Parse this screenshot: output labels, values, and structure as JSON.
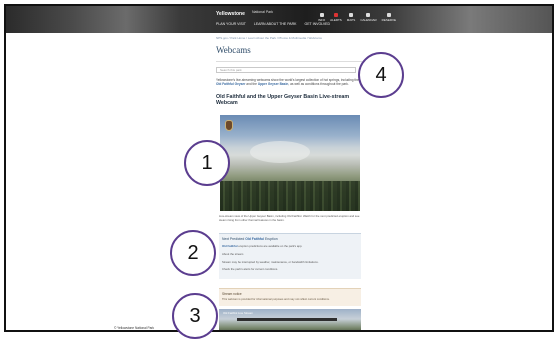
{
  "banner": {
    "brand": "Yellowstone",
    "brand_sub": "National Park",
    "nav": [
      "PLAN YOUR VISIT",
      "LEARN ABOUT THE PARK",
      "GET INVOLVED"
    ],
    "utilities": [
      "INFO",
      "ALERTS",
      "MAPS",
      "CALENDAR",
      "RESERVE"
    ]
  },
  "breadcrumb": "NPS.gov / Park Home / Learn About the Park / Photos & Multimedia / Webcams",
  "page_title": "Webcams",
  "search_placeholder": "Search this park",
  "intro": {
    "text_before": "Yellowstone's live-streaming webcams show the world's largest collection of hot springs, including the ",
    "link1": "Old Faithful Geyser",
    "text_middle": " and the ",
    "link2": "Upper Geyser Basin",
    "text_after": ", as well as conditions throughout the park."
  },
  "section_title": "Old Faithful and the Upper Geyser Basin Live-stream Webcam",
  "caption": "Live-stream view of the Upper Geyser Basin, including Old Faithful. Watch for the next predicted eruption and see steam rising from other thermal features in the basin.",
  "box_info": {
    "title_prefix": "Next Predicted ",
    "title_link": "Old Faithful",
    "title_suffix": " Eruption",
    "line1_link": "Old Faithful",
    "line1_text": " eruption predictions are available on the park's app.",
    "line2_title": "About the stream",
    "line3": "Stream may be interrupted by weather, maintenance, or bandwidth limitations.",
    "line4": "Check the park's alerts for current conditions."
  },
  "box_notice": {
    "title": "Stream notice",
    "text": "This webcam is provided for informational purposes and may not reflect current conditions."
  },
  "cam2_label": "Old Faithful Live Stream",
  "footer_note": "© Yellowstone National Park",
  "markers": [
    "1",
    "2",
    "3",
    "4"
  ],
  "icons": {
    "search": "search-icon",
    "logo": "arrowhead-logo-icon"
  }
}
